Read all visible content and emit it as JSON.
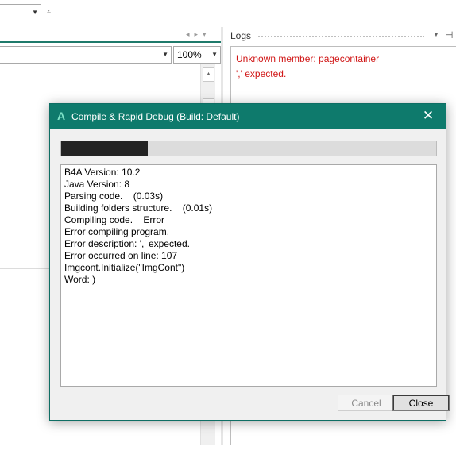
{
  "toolbar": {
    "combo_value": ""
  },
  "editor": {
    "member_combo_value": "",
    "zoom": "100%"
  },
  "logs": {
    "title": "Logs",
    "lines": [
      "Unknown member: pagecontainer",
      "',' expected."
    ]
  },
  "dialog": {
    "title": "Compile & Rapid Debug (Build: Default)",
    "app_icon_letter": "A",
    "progress_fraction": 0.23,
    "output_lines": [
      "B4A Version: 10.2",
      "Java Version: 8",
      "Parsing code.    (0.03s)",
      "Building folders structure.    (0.01s)",
      "Compiling code.    Error",
      "Error compiling program.",
      "Error description: ',' expected.",
      "Error occurred on line: 107",
      "Imgcont.Initialize(\"ImgCont\")",
      "Word: )"
    ],
    "cancel_label": "Cancel",
    "close_label": "Close"
  },
  "colors": {
    "title_bar": "#0e7a6c",
    "error_text": "#d01515",
    "progress_fill": "#232323"
  },
  "icons": [
    "dropdown-arrow-icon",
    "overflow-icon",
    "nav-arrows-icon",
    "pin-icon",
    "close-icon",
    "app-logo-icon",
    "scroll-up-icon"
  ]
}
